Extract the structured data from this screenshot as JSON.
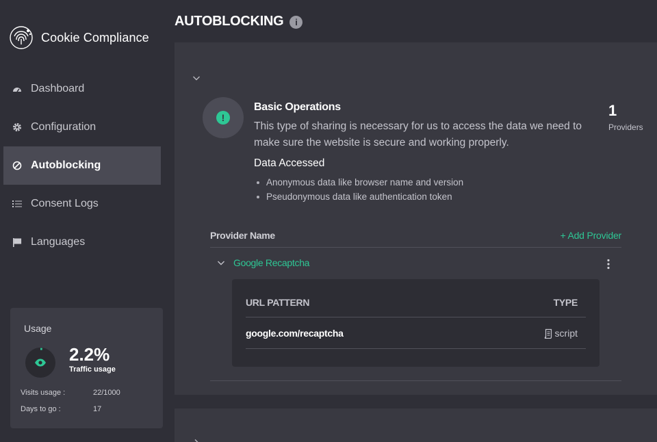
{
  "brand": {
    "name": "Cookie Compliance",
    "icon": "fingerprint-icon"
  },
  "sidebar": {
    "items": [
      {
        "label": "Dashboard",
        "icon": "gauge-icon",
        "active": false
      },
      {
        "label": "Configuration",
        "icon": "gear-icon",
        "active": false
      },
      {
        "label": "Autoblocking",
        "icon": "block-icon",
        "active": true
      },
      {
        "label": "Consent Logs",
        "icon": "list-icon",
        "active": false
      },
      {
        "label": "Languages",
        "icon": "flag-icon",
        "active": false
      }
    ]
  },
  "usage": {
    "title": "Usage",
    "percent": "2.2%",
    "percent_value": 2.2,
    "percent_label": "Traffic usage",
    "visits_label": "Visits usage :",
    "visits_value": "22/1000",
    "days_label": "Days to go :",
    "days_value": "17"
  },
  "page": {
    "title": "AUTOBLOCKING",
    "info_icon": "i"
  },
  "category": {
    "badge": "!",
    "title": "Basic Operations",
    "description": "This type of sharing is necessary for us to access the data we need to make sure the website is secure and working properly.",
    "data_title": "Data Accessed",
    "data_items": [
      "Anonymous data like browser name and version",
      "Pseudonymous data like authentication token"
    ],
    "providers_count": "1",
    "providers_label": "Providers"
  },
  "providers": {
    "header": "Provider Name",
    "add_label": "+ Add Provider",
    "items": [
      {
        "name": "Google Recaptcha",
        "columns": {
          "url": "URL PATTERN",
          "type": "TYPE"
        },
        "rows": [
          {
            "pattern": "google.com/recaptcha",
            "type": "script"
          }
        ]
      }
    ]
  },
  "colors": {
    "accent": "#2ec795",
    "background": "#2f2f37",
    "panel": "#393941",
    "active_nav": "#4a4a54"
  }
}
